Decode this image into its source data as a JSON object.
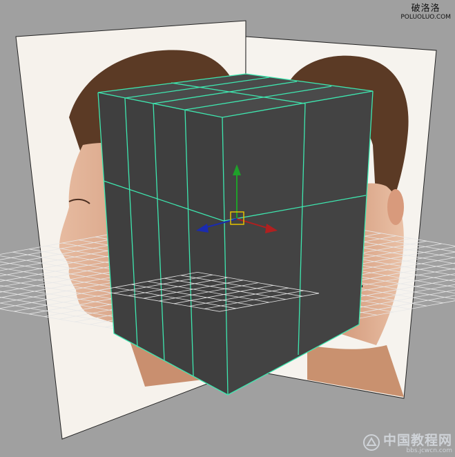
{
  "viewport": {
    "background_color": "#a0a0a0",
    "cube_color": "#404040",
    "wire_color": "#3ee8b0",
    "grid_color": "#e8e8e8"
  },
  "manipulator": {
    "y_axis_color": "#1fa12a",
    "x_axis_color": "#b02020",
    "z_axis_color": "#1a2bb0",
    "pivot_color": "#e6c200"
  },
  "image_planes": {
    "side_view_label": "side-reference-image",
    "front_view_label": "front-reference-image",
    "hair_color": "#5b3a25",
    "skin_color": "#d8a586"
  },
  "watermark_top": {
    "chinese": "破洛洛",
    "url": "POLUOLUO.COM"
  },
  "watermark_bottom": {
    "chinese": "中国教程网",
    "url": "bbs.jcwcn.com"
  }
}
